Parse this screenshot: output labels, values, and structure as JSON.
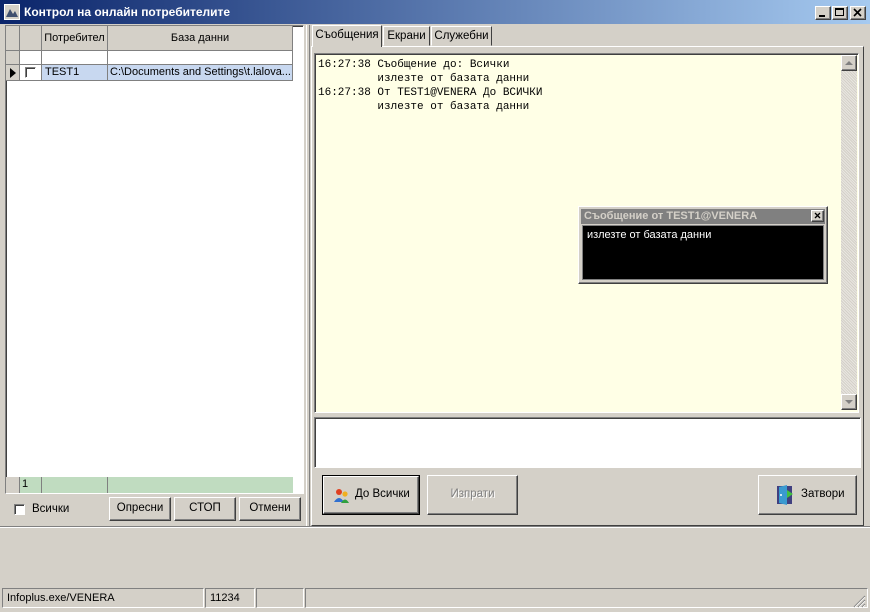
{
  "window": {
    "title": "Контрол на онлайн потребителите"
  },
  "grid": {
    "columns": [
      "Потребител",
      "База данни"
    ],
    "rows": [
      {
        "user": "TEST1",
        "database": "C:\\Documents and Settings\\t.lalova..."
      }
    ],
    "footer_count": "1"
  },
  "left_controls": {
    "all_checkbox_label": "Всички",
    "refresh_label": "Опресни",
    "stop_label": "СТОП",
    "cancel_label": "Отмени"
  },
  "tabs": [
    "Съобщения",
    "Екрани",
    "Служебни"
  ],
  "messages": {
    "lines": [
      "16:27:38 Съобщение до: Всички",
      "         излезте от базата данни",
      "16:27:38 От TEST1@VENERA До ВСИЧКИ",
      "         излезте от базата данни"
    ]
  },
  "popup": {
    "title": "Съобщение от TEST1@VENERA",
    "text": "излезте от базата данни"
  },
  "compose": {
    "value": ""
  },
  "buttons": {
    "to_all_label": "До Всички",
    "send_label": "Изпрати",
    "close_label": "Затвори"
  },
  "status_bar": {
    "panel1": "Infoplus.exe/VENERA",
    "panel2": "11234",
    "panel3": "",
    "panel4": ""
  },
  "colors": {
    "title_start": "#0a246a",
    "title_end": "#a6caf0",
    "message_bg": "#ffffe6",
    "selected_row": "#c8d8f0",
    "grid_footer": "#c0dcc0",
    "popup_bg": "#000000",
    "popup_title_bg": "#808080"
  }
}
